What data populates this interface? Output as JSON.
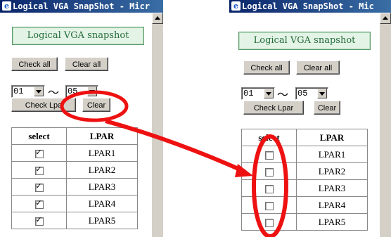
{
  "left": {
    "title": "Logical VGA SnapShot - Micr",
    "banner": "Logical VGA snapshot",
    "check_all": "Check all",
    "clear_all": "Clear all",
    "from_value": "01",
    "tilde": "〜",
    "to_value": "05",
    "check_lpar": "Check Lpa",
    "clear": "Clear",
    "table": {
      "headers": [
        "select",
        "LPAR"
      ],
      "rows": [
        {
          "checked": true,
          "name": "LPAR1"
        },
        {
          "checked": true,
          "name": "LPAR2"
        },
        {
          "checked": true,
          "name": "LPAR3"
        },
        {
          "checked": true,
          "name": "LPAR4"
        },
        {
          "checked": true,
          "name": "LPAR5"
        }
      ]
    }
  },
  "right": {
    "title": "Logical VGA SnapShot - Mic",
    "banner": "Logical VGA snapshot",
    "check_all": "Check all",
    "clear_all": "Clear all",
    "from_value": "01",
    "tilde": "〜",
    "to_value": "05",
    "check_lpar": "Check Lpar",
    "clear": "Clear",
    "table": {
      "headers": [
        "select",
        "LPAR"
      ],
      "rows": [
        {
          "checked": false,
          "name": "LPAR1"
        },
        {
          "checked": false,
          "name": "LPAR2"
        },
        {
          "checked": false,
          "name": "LPAR3"
        },
        {
          "checked": false,
          "name": "LPAR4"
        },
        {
          "checked": false,
          "name": "LPAR5"
        }
      ]
    }
  },
  "annotation_color": "#ee1111"
}
